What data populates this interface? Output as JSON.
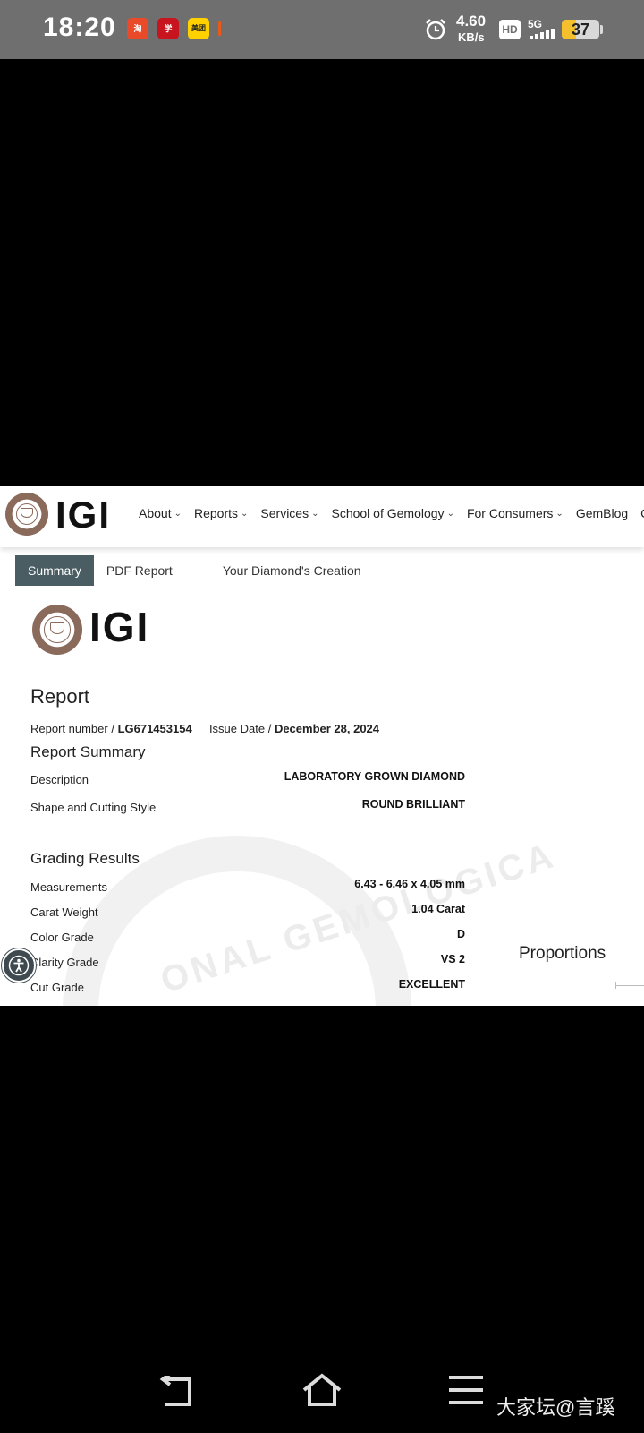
{
  "status_bar": {
    "time": "18:20",
    "apps": [
      "淘",
      "学",
      "美团"
    ],
    "speed_value": "4.60",
    "speed_unit": "KB/s",
    "hd": "HD",
    "network": "5G",
    "battery": "37",
    "battery_fraction": 0.37,
    "icons": [
      "alarm-icon",
      "signal-icon"
    ]
  },
  "site": {
    "wordmark": "IGI",
    "nav": [
      "About",
      "Reports",
      "Services",
      "School of Gemology",
      "For Consumers",
      "GemBlog",
      "C"
    ]
  },
  "tabs": [
    "Summary",
    "PDF Report",
    "Your Diamond's Creation"
  ],
  "report": {
    "wordmark": "IGI",
    "title": "Report",
    "number_label": "Report number /",
    "number": "LG671453154",
    "date_label": "Issue Date /",
    "date": "December 28, 2024",
    "summary_title": "Report Summary",
    "summary": [
      {
        "label": "Description",
        "value": "LABORATORY GROWN DIAMOND"
      },
      {
        "label": "Shape and Cutting Style",
        "value": "ROUND BRILLIANT"
      }
    ],
    "grading_title": "Grading Results",
    "grading": [
      {
        "label": "Measurements",
        "value": "6.43 - 6.46 x 4.05 mm"
      },
      {
        "label": "Carat Weight",
        "value": "1.04 Carat"
      },
      {
        "label": "Color Grade",
        "value": "D"
      },
      {
        "label": "Clarity Grade",
        "value": "VS 2"
      },
      {
        "label": "Cut Grade",
        "value": "EXCELLENT"
      }
    ],
    "proportions_title": "Proportions",
    "watermark": "ONAL GEMOLOGICA"
  },
  "footer": {
    "brand": "大家坛@言蹊"
  }
}
